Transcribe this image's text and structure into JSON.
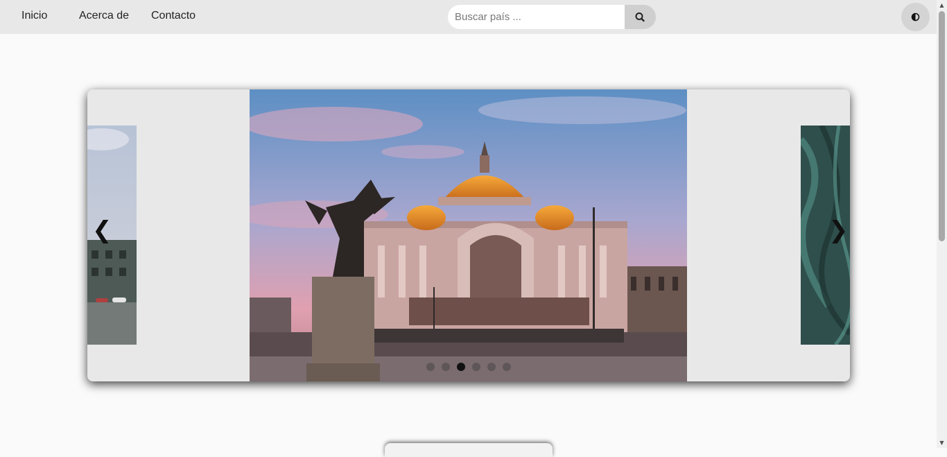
{
  "nav": {
    "links": [
      "Inicio",
      "Acerca de",
      "Contacto"
    ],
    "search_placeholder": "Buscar país ...",
    "search_icon": "search-icon",
    "theme_icon": "contrast-icon"
  },
  "carousel": {
    "prev_label": "❮",
    "next_label": "❯",
    "dot_count": 6,
    "active_index": 2,
    "slides": [
      "left-peek-city-street",
      "palacio-de-bellas-artes",
      "right-peek-teal-texture"
    ]
  }
}
